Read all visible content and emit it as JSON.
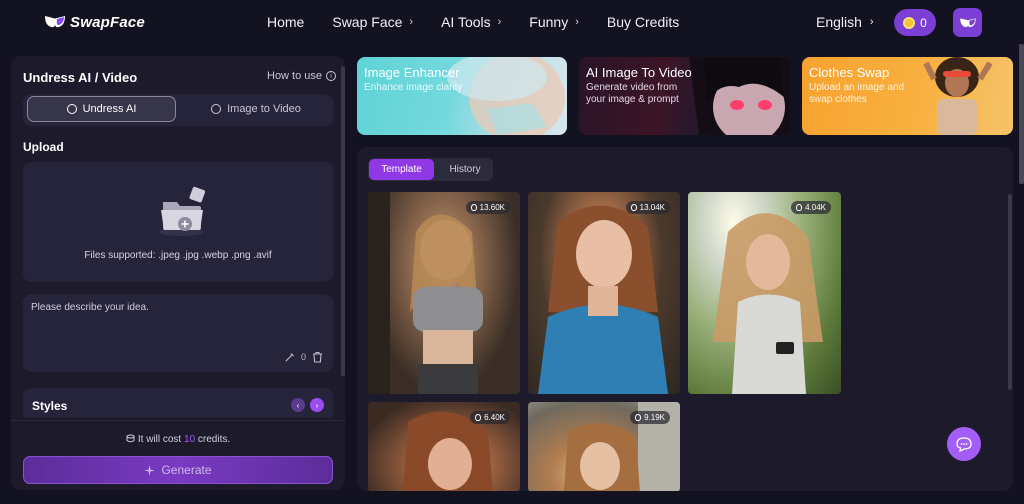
{
  "header": {
    "brand": "SwapFace",
    "nav": [
      {
        "label": "Home",
        "has_chevron": false
      },
      {
        "label": "Swap Face",
        "has_chevron": true
      },
      {
        "label": "AI Tools",
        "has_chevron": true
      },
      {
        "label": "Funny",
        "has_chevron": true
      },
      {
        "label": "Buy Credits",
        "has_chevron": false
      }
    ],
    "language": "English",
    "credits": "0",
    "chevron": "›"
  },
  "left_panel": {
    "title": "Undress AI / Video",
    "how_to_use": "How to use",
    "tabs": [
      {
        "label": "Undress AI",
        "active": true
      },
      {
        "label": "Image to Video",
        "active": false
      }
    ],
    "upload_label": "Upload",
    "files_supported": "Files supported: .jpeg .jpg .webp .png .avif",
    "idea_placeholder": "Please describe your idea.",
    "idea_count": "0",
    "styles_label": "Styles",
    "arrow_prev": "‹",
    "arrow_next": "›",
    "cost_prefix": "It will cost ",
    "cost_value": "10",
    "cost_suffix": " credits.",
    "generate_label": "Generate"
  },
  "feature_cards": [
    {
      "title": "Image Enhancer",
      "desc": "Enhance image clarity"
    },
    {
      "title": "AI Image To Video",
      "desc": "Generate video from your image & prompt"
    },
    {
      "title": "Clothes Swap",
      "desc": "Upload an image and swap clothes"
    }
  ],
  "gallery": {
    "tabs": [
      {
        "label": "Template",
        "active": true
      },
      {
        "label": "History",
        "active": false
      }
    ],
    "items": [
      {
        "count": "13.60K"
      },
      {
        "count": "13.04K"
      },
      {
        "count": "4.04K"
      },
      {
        "count": "6.40K"
      },
      {
        "count": "9.19K"
      }
    ]
  },
  "colors": {
    "accent": "#9038e6",
    "background": "#131220",
    "panel": "#1d1b2b"
  },
  "icons": [
    "mask-logo-icon",
    "coin-icon",
    "mask-avatar-icon",
    "info-icon",
    "undress-icon",
    "video-icon",
    "upload-folder-icon",
    "pen-icon",
    "trash-icon",
    "credits-icon",
    "sparkle-icon",
    "fire-icon",
    "chat-icon"
  ]
}
